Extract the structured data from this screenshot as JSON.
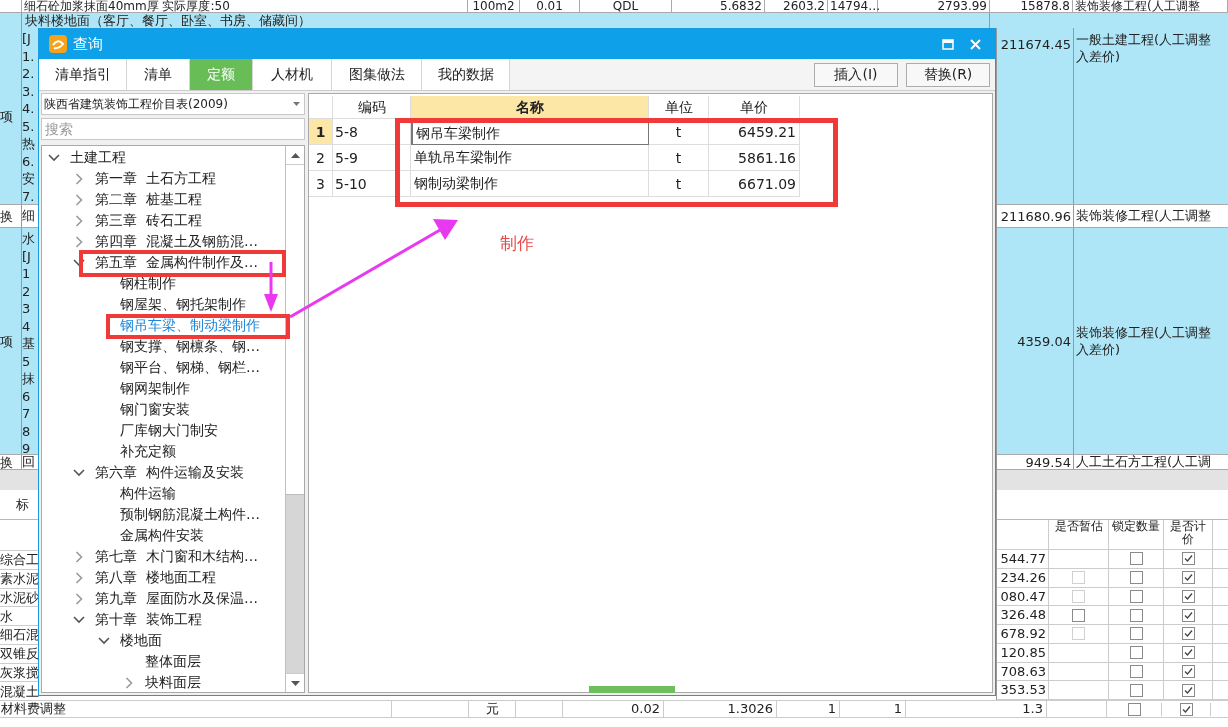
{
  "sheet": {
    "top_row": [
      "细石砼加浆抹面40mm厚  实际厚度:50",
      "100m2",
      "0.01",
      "QDL",
      "5.6832",
      "2603.2",
      "14794…",
      "2793.99",
      "15878.8",
      "装饰装修工程(人工调整"
    ],
    "band_text": "块料楼地面（客厅、餐厅、卧室、书房、储藏间）",
    "sections": [
      {
        "kind": "blue",
        "mark": "项",
        "lines": [
          "[J",
          "1.",
          "2.",
          "3.",
          "4.",
          "5.",
          "热",
          "6.",
          "安",
          "7."
        ],
        "amount": "211674.45",
        "description": [
          "一般土建工程(人工调整",
          "入差价)"
        ]
      },
      {
        "kind": "white",
        "mark": "换",
        "lines": [
          "细"
        ],
        "amount": "211680.96",
        "description": [
          "装饰装修工程(人工调整"
        ]
      },
      {
        "kind": "blue",
        "mark": "项",
        "lines": [
          "水",
          "[J",
          "1",
          "2",
          "3",
          "4",
          "基",
          "5",
          "抹",
          "6",
          "7",
          "8",
          "9"
        ],
        "amount": "4359.04",
        "description": [
          "装饰装修工程(人工调整",
          "入差价)"
        ]
      },
      {
        "kind": "white",
        "mark": "换",
        "lines": [
          "回"
        ],
        "amount": "949.54",
        "description": [
          "人工土石方工程(人工调"
        ]
      }
    ],
    "lower_tab": "标",
    "lower_headers": [
      "是否暂估",
      "锁定数量",
      "是否计价"
    ],
    "lower_rows": [
      {
        "name": "综合工",
        "amount": "544.77",
        "locked": false,
        "priced": true
      },
      {
        "name": "素水泥",
        "amount": "234.26",
        "provisional_disabled": true,
        "locked": false,
        "priced": true
      },
      {
        "name": "水泥砂",
        "amount": "080.47",
        "provisional_disabled": true,
        "locked": false,
        "priced": true
      },
      {
        "name": "水",
        "amount": "326.48",
        "provisional_disabled": false,
        "locked": false,
        "priced": true
      },
      {
        "name": "细石混",
        "amount": "678.92",
        "provisional_disabled": true,
        "locked": false,
        "priced": true
      },
      {
        "name": "双锥反",
        "amount": "120.85",
        "locked": false,
        "priced": true
      },
      {
        "name": "灰浆搅",
        "amount": "708.63",
        "locked": false,
        "priced": true
      },
      {
        "name": "混凝土",
        "amount": "353.53",
        "locked": false,
        "priced": true
      }
    ],
    "last_row": {
      "name": "材料费调整",
      "unit": "元",
      "cells": [
        "0.02",
        "1.3026",
        "1",
        "1",
        "1.3"
      ],
      "locked": false,
      "priced": true
    }
  },
  "dialog": {
    "title": "查询",
    "tabs": [
      {
        "label": "清单指引",
        "selected": false
      },
      {
        "label": "清单",
        "selected": false
      },
      {
        "label": "定额",
        "selected": true
      },
      {
        "label": "人材机",
        "selected": false
      },
      {
        "label": "图集做法",
        "selected": false
      },
      {
        "label": "我的数据",
        "selected": false
      }
    ],
    "buttons": [
      "插入(I)",
      "替换(R)"
    ],
    "library": "陕西省建筑装饰工程价目表(2009)",
    "search_placeholder": "搜索",
    "tree": [
      {
        "label": "土建工程",
        "kind": "branch",
        "expanded": true,
        "selected": false,
        "children": [
          {
            "label": "第一章  土石方工程",
            "kind": "branch",
            "expanded": false,
            "selected": false
          },
          {
            "label": "第二章  桩基工程",
            "kind": "branch",
            "expanded": false,
            "selected": false
          },
          {
            "label": "第三章  砖石工程",
            "kind": "branch",
            "expanded": false,
            "selected": false
          },
          {
            "label": "第四章  混凝土及钢筋混…",
            "kind": "branch",
            "expanded": false,
            "selected": false
          },
          {
            "label": "第五章  金属构件制作及…",
            "kind": "branch",
            "expanded": true,
            "selected": false,
            "children": [
              {
                "label": "钢柱制作",
                "kind": "leaf",
                "selected": false
              },
              {
                "label": "钢屋架、钢托架制作",
                "kind": "leaf",
                "selected": false
              },
              {
                "label": "钢吊车梁、制动梁制作",
                "kind": "leaf",
                "selected": true
              },
              {
                "label": "钢支撑、钢檩条、钢…",
                "kind": "leaf",
                "selected": false
              },
              {
                "label": "钢平台、钢梯、钢栏…",
                "kind": "leaf",
                "selected": false
              },
              {
                "label": "钢网架制作",
                "kind": "leaf",
                "selected": false
              },
              {
                "label": "钢门窗安装",
                "kind": "leaf",
                "selected": false
              },
              {
                "label": "厂库钢大门制安",
                "kind": "leaf",
                "selected": false
              },
              {
                "label": "补充定额",
                "kind": "leaf",
                "selected": false
              }
            ]
          },
          {
            "label": "第六章  构件运输及安装",
            "kind": "branch",
            "expanded": true,
            "selected": false,
            "children": [
              {
                "label": "构件运输",
                "kind": "leaf",
                "selected": false
              },
              {
                "label": "预制钢筋混凝土构件…",
                "kind": "leaf",
                "selected": false
              },
              {
                "label": "金属构件安装",
                "kind": "leaf",
                "selected": false
              }
            ]
          },
          {
            "label": "第七章  木门窗和木结构…",
            "kind": "branch",
            "expanded": false,
            "selected": false
          },
          {
            "label": "第八章  楼地面工程",
            "kind": "branch",
            "expanded": false,
            "selected": false
          },
          {
            "label": "第九章  屋面防水及保温…",
            "kind": "branch",
            "expanded": false,
            "selected": false
          },
          {
            "label": "第十章  装饰工程",
            "kind": "branch",
            "expanded": true,
            "selected": false,
            "children": [
              {
                "label": "楼地面",
                "kind": "branch",
                "expanded": true,
                "selected": false,
                "children": [
                  {
                    "label": "整体面层",
                    "kind": "leaf",
                    "selected": false
                  },
                  {
                    "label": "块料面层",
                    "kind": "branch",
                    "expanded": false,
                    "selected": false
                  }
                ]
              }
            ]
          }
        ]
      }
    ],
    "table": {
      "columns": [
        "编码",
        "名称",
        "单位",
        "单价"
      ],
      "rows": [
        {
          "number": "1",
          "code": "5-8",
          "name": "钢吊车梁制作",
          "unit": "t",
          "price": "6459.21",
          "selected": true
        },
        {
          "number": "2",
          "code": "5-9",
          "name": "单轨吊车梁制作",
          "unit": "t",
          "price": "5861.16",
          "selected": false
        },
        {
          "number": "3",
          "code": "5-10",
          "name": "钢制动梁制作",
          "unit": "t",
          "price": "6671.09",
          "selected": false
        }
      ]
    }
  },
  "annotation": {
    "label": "制作"
  }
}
